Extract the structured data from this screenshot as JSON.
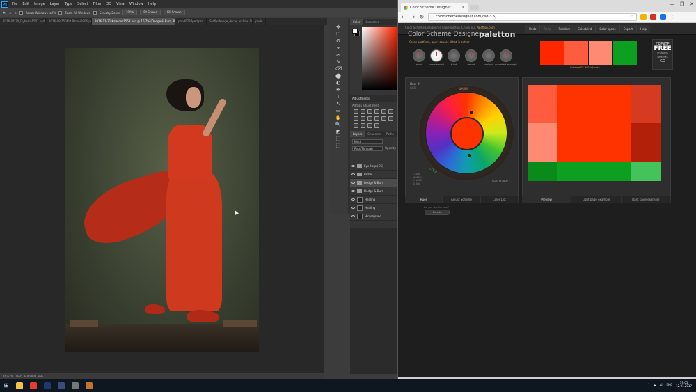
{
  "photoshop": {
    "logo": "Ps",
    "menu": [
      "File",
      "Edit",
      "Image",
      "Layer",
      "Type",
      "Select",
      "Filter",
      "3D",
      "View",
      "Window",
      "Help"
    ],
    "options": {
      "zoom_icons": [
        "🔍",
        "⊕",
        "⊖"
      ],
      "resize_label": "Resize Windows to Fit",
      "zoom_all_label": "Zoom All Windows",
      "scrubby_label": "Scrubby Zoom",
      "btn_100": "100%",
      "btn_fit": "Fit Screen",
      "btn_fill": "Fill Screen"
    },
    "doc_tabs": [
      {
        "label": "2016-07-20_Dybalko1507.psd",
        "active": false
      },
      {
        "label": "2016-08-15 Wilt Bilmei1906.psd",
        "active": false
      },
      {
        "label": "2016-11-21 Kaleidos1558.psd @ 16,7% (Dodge & Burn, RGB/16)",
        "active": true
      },
      {
        "label": "pond0737ped.psd",
        "active": false
      },
      {
        "label": "Stefixchange_decay archive 0l.psd",
        "active": false
      },
      {
        "label": "pods",
        "active": false
      }
    ],
    "status": [
      "16,67%",
      "Doc: 344,9M/7,66G"
    ],
    "tools": [
      "✥",
      "⬚",
      "ʘ",
      "⌖",
      "✂",
      "✎",
      "⌫",
      "⬤",
      "◐",
      "✒",
      "T",
      "↖",
      "▭",
      "✋",
      "🔍",
      "◩",
      "⬚",
      "⬚"
    ],
    "panels": {
      "color_tabs": [
        "Color",
        "Swatches"
      ],
      "adjustments_title": "Adjustments",
      "adjustments_sub": "Add an adjustment",
      "layer_tabs": [
        "Layers",
        "Channels",
        "Paths"
      ],
      "kind": "Kind",
      "mode": "Pass Through",
      "opacity": "Opacity:",
      "layers": [
        {
          "name": "Eye Help (CC)",
          "type": "folder",
          "selected": false
        },
        {
          "name": "Farbe",
          "type": "folder",
          "selected": false
        },
        {
          "name": "Dodge & Burn",
          "type": "folder",
          "selected": true
        },
        {
          "name": "Dodge & Burn",
          "type": "folder",
          "selected": false
        },
        {
          "name": "Healing",
          "type": "layer",
          "selected": false
        },
        {
          "name": "Healing",
          "type": "layer",
          "selected": false
        },
        {
          "name": "Hintergrund",
          "type": "layer",
          "selected": false
        }
      ]
    }
  },
  "chrome": {
    "tab_title": "Color Scheme Designer",
    "url": "colorschemedesigner.com/csd-3.5/",
    "window_controls": [
      "—",
      "❐",
      "✕"
    ]
  },
  "site": {
    "top_note_prefix": "Color Scheme Designer is now Paletton. Check out ",
    "top_note_link": "Paletton.com",
    "nav": [
      {
        "label": "Undo",
        "dim": false
      },
      {
        "label": "Redo",
        "dim": true
      },
      {
        "label": "Random",
        "dim": false
      },
      {
        "label": "Colorblind",
        "dim": false
      },
      {
        "label": "Color space",
        "dim": false
      },
      {
        "label": "Export",
        "dim": false
      },
      {
        "label": "Help",
        "dim": false
      }
    ],
    "brand": "Color Scheme Designer",
    "brand_arrow": "⇒",
    "brand_new": "paletton",
    "brand_sub": "Cross-platform, open-source",
    "brand_sub_link": "What is better",
    "modes": [
      {
        "label": "mono",
        "active": false
      },
      {
        "label": "complement",
        "active": true
      },
      {
        "label": "triad",
        "active": false
      },
      {
        "label": "tetrad",
        "active": false
      },
      {
        "label": "analogic",
        "active": false
      },
      {
        "label": "accented analogic",
        "active": false
      }
    ],
    "swatches": [
      "#ff2600",
      "#ff5b3e",
      "#ff8a73",
      "#0da020"
    ],
    "scheme_id_prefix": "Scheme ID:",
    "scheme_id": "3011sJwwsa",
    "ad": {
      "line1": "CREATE",
      "line2": "FREE",
      "line3": "STUNNING WEBSITES",
      "line4": "GO"
    },
    "hue_label": "Hue:",
    "hue_value": "0°",
    "hue_sub": "RGB",
    "wheel_top_text": "WARM",
    "wheel_bottom_text": "COLD",
    "cmyk": [
      "C: 0%",
      "M: 85%",
      "Y: 100%",
      "K: 0%"
    ],
    "rgb_readout": "RGB: FF2600",
    "left_tabs": [
      {
        "label": "Hues",
        "active": true
      },
      {
        "label": "Adjust Scheme",
        "active": false
      },
      {
        "label": "Color List",
        "active": false
      }
    ],
    "right_tabs": [
      {
        "label": "Preview",
        "active": true
      },
      {
        "label": "Light page example",
        "active": false
      },
      {
        "label": "Dark page example",
        "active": false
      }
    ],
    "bottom_note": "Do you like the tool?",
    "bottom_button": "Donate"
  },
  "taskbar": {
    "start": "⊞",
    "apps": [
      {
        "name": "explorer",
        "color": "#f5c342"
      },
      {
        "name": "chrome",
        "color": "#e53d2f"
      },
      {
        "name": "photoshop",
        "color": "#1b3a6b"
      },
      {
        "name": "lightroom",
        "color": "#3a4b7a"
      },
      {
        "name": "media-player",
        "color": "#777"
      },
      {
        "name": "bridge",
        "color": "#c7742b"
      }
    ],
    "time": "19:05",
    "date": "12.01.2017",
    "tray_icons": [
      "^",
      "☁",
      "🔊",
      "ENG"
    ]
  }
}
